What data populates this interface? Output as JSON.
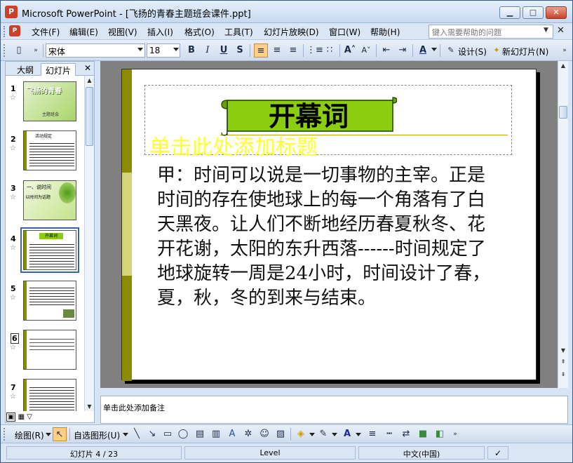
{
  "window": {
    "title": "Microsoft PowerPoint - [飞扬的青春主题班会课件.ppt]",
    "app_icon": "powerpoint-icon",
    "minimize": "▁",
    "maximize": "□",
    "close": "✕"
  },
  "menu": {
    "items": [
      "文件(F)",
      "编辑(E)",
      "视图(V)",
      "插入(I)",
      "格式(O)",
      "工具(T)",
      "幻灯片放映(D)",
      "窗口(W)",
      "帮助(H)"
    ],
    "help_placeholder": "键入需要帮助的问题",
    "close": "✕"
  },
  "toolbar": {
    "font_name": "宋体",
    "font_size": "18",
    "bold": "B",
    "italic": "I",
    "underline": "U",
    "shadow": "S",
    "design_label": "设计(S)",
    "new_slide_label": "新幻灯片(N)"
  },
  "left_panel": {
    "tab_outline": "大纲",
    "tab_slides": "幻灯片",
    "close": "✕",
    "slide_numbers": [
      "1",
      "2",
      "3",
      "4",
      "5",
      "6",
      "7"
    ],
    "thumb1_title": "飞扬的青春",
    "thumb1_sub": "主题班会",
    "thumb2_title": "活动规定",
    "thumb3_title": "一、说时间",
    "thumb3_sub": "以时间为话题",
    "thumb4_title": "开幕词"
  },
  "slide": {
    "banner_text": "开幕词",
    "title_placeholder": "单击此处添加标题",
    "body_text": "甲：时间可以说是一切事物的主宰。正是时间的存在使地球上的每一个角落有了白天黑夜。让人们不断地经历春夏秋冬、花开花谢，太阳的东升西落------时间规定了地球旋转一周是24小时，时间设计了春，夏，秋，冬的到来与结束。"
  },
  "notes": {
    "placeholder": "单击此处添加备注"
  },
  "drawing_toolbar": {
    "draw_label": "绘图(R)",
    "autoshapes_label": "自选图形(U)"
  },
  "status": {
    "slide_info": "幻灯片 4 / 23",
    "design": "Level",
    "language": "中文(中国)"
  },
  "colors": {
    "accent_olive": "#8b8b00",
    "accent_light": "#d4d478",
    "banner_green": "#8ccd10",
    "placeholder_yellow": "#ffff33",
    "chrome_blue": "#d6e4f5"
  }
}
